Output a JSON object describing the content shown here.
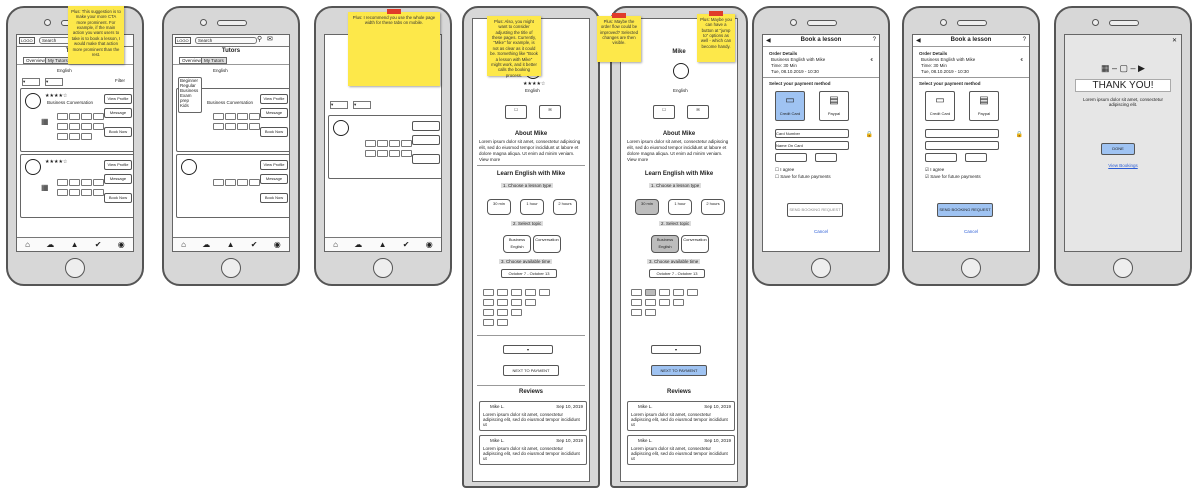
{
  "stickies": {
    "s1": "Plus: This suggestion is to make your more CTA more prominent. For example, if the main action you want users to take is to book a lesson, I would make that action more prominent than the rest.",
    "s3": "Plus: I recommend you use the whole page width for these tabs on mobile.",
    "s4": "Plus: Also, you might want to consider adjusting the title of these pages. Currently, \"Mike\" for example, is not as clear as it could be. Something like \"Book a lesson with Mike\" might work, and it better calls the booking process.",
    "s5a": "Plus: Maybe the order flow could be improved? Selected changes are then visible.",
    "s5b": "Plus: Maybe you can have a button at \"jump to\" options as well - which can become handy."
  },
  "screen1": {
    "app": "Tutors",
    "search_placeholder": "Search",
    "tabs": [
      "Overview",
      "My Tutors"
    ],
    "language": "English",
    "filter_label": "Filter",
    "tutor_stars": "★★★★☆",
    "tutor_subject": "Business Conversation",
    "btn_view_profile": "View Profile",
    "btn_message": "Message",
    "btn_book_now": "Book Now"
  },
  "screen2": {
    "app": "Tutors",
    "search_placeholder": "Search",
    "tabs": [
      "Overview",
      "My Tutors"
    ],
    "language": "English",
    "dropdown_items": [
      "Beginner",
      "Regular",
      "Business",
      "Exam prep",
      "Kids"
    ],
    "tutor_subject": "Business Conversation",
    "btn_view_profile": "View Profile",
    "btn_message": "Message",
    "btn_book_now": "Book Now"
  },
  "screen4": {
    "name": "Mike",
    "lang": "English",
    "about_title": "About Mike",
    "about_text": "Lorem ipsum dolor sit amet, consectetur adipiscing elit, sed do eiusmod tempor incididunt ut labore et dolore magna aliqua. Ut enim ad minim veniam. View more",
    "learn_title": "Learn English with Mike",
    "step1": "1. Choose a lesson type",
    "durations": [
      "30 min",
      "1 hour",
      "2 hours"
    ],
    "step2": "2. Select topic",
    "topics": [
      "Business English",
      "Conversation"
    ],
    "step3": "3. Choose available time",
    "week": "October 7 - October 13",
    "next_button": "NEXT TO PAYMENT",
    "reviews_title": "Reviews",
    "review_author": "Mike L.",
    "review_date": "Sep 10, 2019",
    "review_text": "Lorem ipsum dolor sit amet, consectetur adipiscing elit, sed do eiusmod tempor incididunt ut"
  },
  "booking": {
    "title": "Book a lesson",
    "order_details": "Order Details",
    "order_line1": "Business English with Mike",
    "order_line2": "Time: 30 Min",
    "order_line3": "Tue, 08.10.2019 - 10:30",
    "price": "€",
    "payment_title": "Select your payment method",
    "methods": [
      "Credit Card",
      "Paypal"
    ],
    "card_number": "Card Number",
    "name_on_card": "Name On Card",
    "checkbox1": "I agree",
    "checkbox2": "Save for future payments",
    "submit": "SEND BOOKING REQUEST",
    "cancel": "Cancel"
  },
  "thanks": {
    "title": "THANK YOU!",
    "body": "Lorem ipsum dolor sit amet, consectetur adipiscing elit.",
    "done": "DONE",
    "link": "View Bookings"
  },
  "colors": {
    "accent": "#9fc3f2",
    "sticky": "#fde84a",
    "pin": "#e03b2a"
  }
}
